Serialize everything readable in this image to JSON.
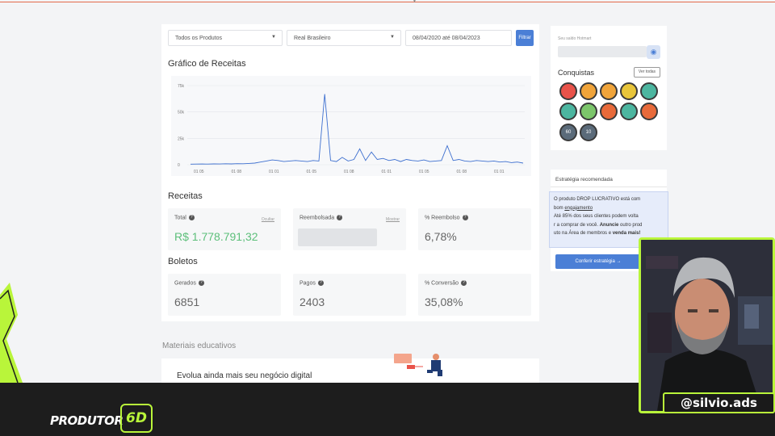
{
  "filters": {
    "product": "Todos os Produtos",
    "currency": "Real Brasileiro",
    "date_range": "08/04/2020 até 08/04/2023",
    "filter_button": "Filtrar"
  },
  "revenue_chart": {
    "title": "Gráfico de Receitas",
    "y_ticks": [
      "75k",
      "50k",
      "25k",
      "0"
    ],
    "x_ticks": [
      "01 05",
      "01 08",
      "01 01",
      "01 05",
      "01 08",
      "01 01",
      "01 05",
      "01 08",
      "01 01"
    ]
  },
  "chart_data": {
    "type": "line",
    "title": "Gráfico de Receitas",
    "xlabel": "",
    "ylabel": "",
    "ylim": [
      0,
      75000
    ],
    "y_ticks": [
      0,
      25000,
      50000,
      75000
    ],
    "grid": true,
    "series": [
      {
        "values": [
          500,
          600,
          700,
          600,
          800,
          700,
          900,
          800,
          1000,
          900,
          1200,
          1500,
          2500,
          3500,
          4500,
          4000,
          3000,
          3500,
          4000,
          3500,
          3000,
          4000,
          3500,
          67000,
          4000,
          3000,
          7000,
          3500,
          5000,
          15000,
          4000,
          12000,
          5000,
          6000,
          4000,
          5000,
          3000,
          5000,
          4000,
          3500,
          4500,
          3000,
          3500,
          4000,
          18000,
          4000,
          5000,
          3500,
          3000,
          4000,
          3500,
          3000,
          3500,
          2500,
          3000,
          2000,
          2500,
          1500
        ]
      }
    ]
  },
  "receitas": {
    "title": "Receitas",
    "total_label": "Total",
    "total_value": "R$ 1.778.791,32",
    "total_link": "Ocultar",
    "reembolsada_label": "Reembolsada",
    "reembolsada_link": "Mostrar",
    "pct_reembolso_label": "% Reembolso",
    "pct_reembolso_value": "6,78%"
  },
  "boletos": {
    "title": "Boletos",
    "gerados_label": "Gerados",
    "gerados_value": "6851",
    "pagos_label": "Pagos",
    "pagos_value": "2403",
    "conversao_label": "% Conversão",
    "conversao_value": "35,08%"
  },
  "materials": {
    "title": "Materiais educativos",
    "heading": "Evolua ainda mais seu negócio digital"
  },
  "sidebar": {
    "saldo_label": "Seu saldo Hotmart",
    "conquistas_title": "Conquistas",
    "ver_todas": "Ver todas",
    "badge_labels": [
      "60",
      "10"
    ],
    "estrategia_title": "Estratégia recomendada",
    "estrategia_line1": "O produto DROP LUCRATIVO está com",
    "estrategia_line2_pre": "bom ",
    "estrategia_line2_link": "engajamento",
    "estrategia_line3": "Até 85% dos seus clientes podem volta",
    "estrategia_line4": "r a comprar de você. ",
    "estrategia_line4_bold": "Anuncie",
    "estrategia_line4_post": " outro prod",
    "estrategia_line5": "uto na Área de membros e ",
    "estrategia_line5_bold": "venda mais!",
    "conferir_button": "Conferir estratégia"
  },
  "overlay": {
    "brand": "PRODUTOR",
    "brand_badge": "6D",
    "handle": "@silvio.ads"
  }
}
